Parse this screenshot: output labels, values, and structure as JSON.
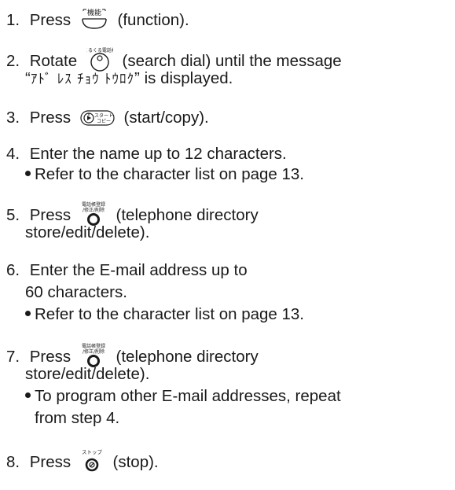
{
  "steps": [
    {
      "num": "1.",
      "before": "Press",
      "icon": "function-key-icon",
      "icon_text": "機能",
      "after": "(function)."
    },
    {
      "num": "2.",
      "before": "Rotate",
      "icon": "search-dial-icon",
      "icon_text": "くるくる電話帳",
      "after": "(search dial) until the message",
      "line2_quote_open": "“",
      "line2_katakana": "ｱﾄﾞ ﾚｽ ﾁｮｳ ﾄｳﾛｸ",
      "line2_rest": "” is displayed."
    },
    {
      "num": "3.",
      "before": "Press",
      "icon": "start-copy-key-icon",
      "icon_text_top": "スタート",
      "icon_text_bottom": "コピー",
      "after": "(start/copy)."
    },
    {
      "num": "4.",
      "text": "Enter the name up to 12 characters.",
      "bullet": "Refer to the character list on page 13."
    },
    {
      "num": "5.",
      "before": "Press",
      "icon": "directory-store-key-icon",
      "icon_text_top": "電話帳登録",
      "icon_text_bottom": "/修正/削除",
      "after": "(telephone directory",
      "line2": "store/edit/delete)."
    },
    {
      "num": "6.",
      "text": "Enter the E-mail address up to",
      "line2": "60 characters.",
      "bullet": "Refer to the character list on page 13."
    },
    {
      "num": "7.",
      "before": "Press",
      "icon": "directory-store-key-icon",
      "icon_text_top": "電話帳登録",
      "icon_text_bottom": "/修正/削除",
      "after": "(telephone directory",
      "line2": "store/edit/delete).",
      "bullet": "To program other E-mail addresses, repeat",
      "bullet_line2": "from step 4."
    },
    {
      "num": "8.",
      "before": "Press",
      "icon": "stop-key-icon",
      "icon_text": "ストップ",
      "after": "(stop)."
    }
  ]
}
